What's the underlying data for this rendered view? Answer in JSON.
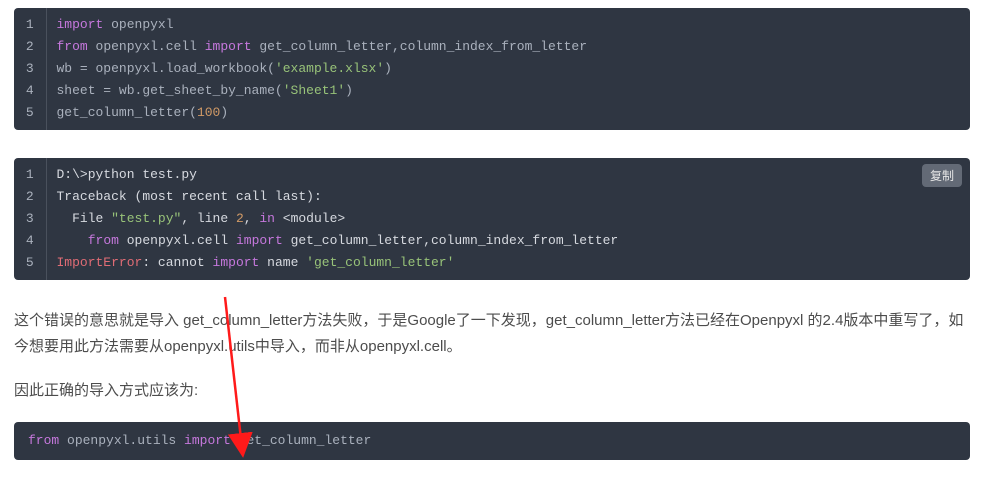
{
  "code1": {
    "lines": [
      [
        {
          "cls": "kw",
          "t": "import"
        },
        {
          "cls": "nm",
          "t": " openpyxl"
        }
      ],
      [
        {
          "cls": "kw",
          "t": "from"
        },
        {
          "cls": "nm",
          "t": " openpyxl.cell "
        },
        {
          "cls": "kw",
          "t": "import"
        },
        {
          "cls": "nm",
          "t": " get_column_letter,column_index_from_letter"
        }
      ],
      [
        {
          "cls": "nm",
          "t": "wb = openpyxl.load_workbook("
        },
        {
          "cls": "str",
          "t": "'example.xlsx'"
        },
        {
          "cls": "nm",
          "t": ")"
        }
      ],
      [
        {
          "cls": "nm",
          "t": "sheet = wb.get_sheet_by_name("
        },
        {
          "cls": "str",
          "t": "'Sheet1'"
        },
        {
          "cls": "nm",
          "t": ")"
        }
      ],
      [
        {
          "cls": "nm",
          "t": "get_column_letter("
        },
        {
          "cls": "num",
          "t": "100"
        },
        {
          "cls": "nm",
          "t": ")"
        }
      ]
    ]
  },
  "code2": {
    "copy_label": "复制",
    "lines": [
      [
        {
          "cls": "white",
          "t": "D:\\>python test.py"
        }
      ],
      [
        {
          "cls": "white",
          "t": "Traceback (most recent call last):"
        }
      ],
      [
        {
          "cls": "white",
          "t": "  File "
        },
        {
          "cls": "str",
          "t": "\"test.py\""
        },
        {
          "cls": "white",
          "t": ", line "
        },
        {
          "cls": "num",
          "t": "2"
        },
        {
          "cls": "white",
          "t": ", "
        },
        {
          "cls": "kw",
          "t": "in"
        },
        {
          "cls": "white",
          "t": " <module>"
        }
      ],
      [
        {
          "cls": "white",
          "t": "    "
        },
        {
          "cls": "kw",
          "t": "from"
        },
        {
          "cls": "white",
          "t": " openpyxl.cell "
        },
        {
          "cls": "kw",
          "t": "import"
        },
        {
          "cls": "white",
          "t": " get_column_letter,column_index_from_letter"
        }
      ],
      [
        {
          "cls": "err",
          "t": "ImportError"
        },
        {
          "cls": "white",
          "t": ": cannot "
        },
        {
          "cls": "kw",
          "t": "import"
        },
        {
          "cls": "white",
          "t": " name "
        },
        {
          "cls": "str",
          "t": "'get_column_letter'"
        }
      ]
    ]
  },
  "para1": "这个错误的意思就是导入 get_column_letter方法失败，于是Google了一下发现，get_column_letter方法已经在Openpyxl 的2.4版本中重写了，如今想要用此方法需要从openpyxl.utils中导入，而非从openpyxl.cell。",
  "para2": "因此正确的导入方式应该为:",
  "code3": {
    "lines": [
      [
        {
          "cls": "kw",
          "t": "from"
        },
        {
          "cls": "nm",
          "t": " openpyxl.utils "
        },
        {
          "cls": "kw",
          "t": "import"
        },
        {
          "cls": "nm",
          "t": " get_column_letter"
        }
      ]
    ]
  }
}
